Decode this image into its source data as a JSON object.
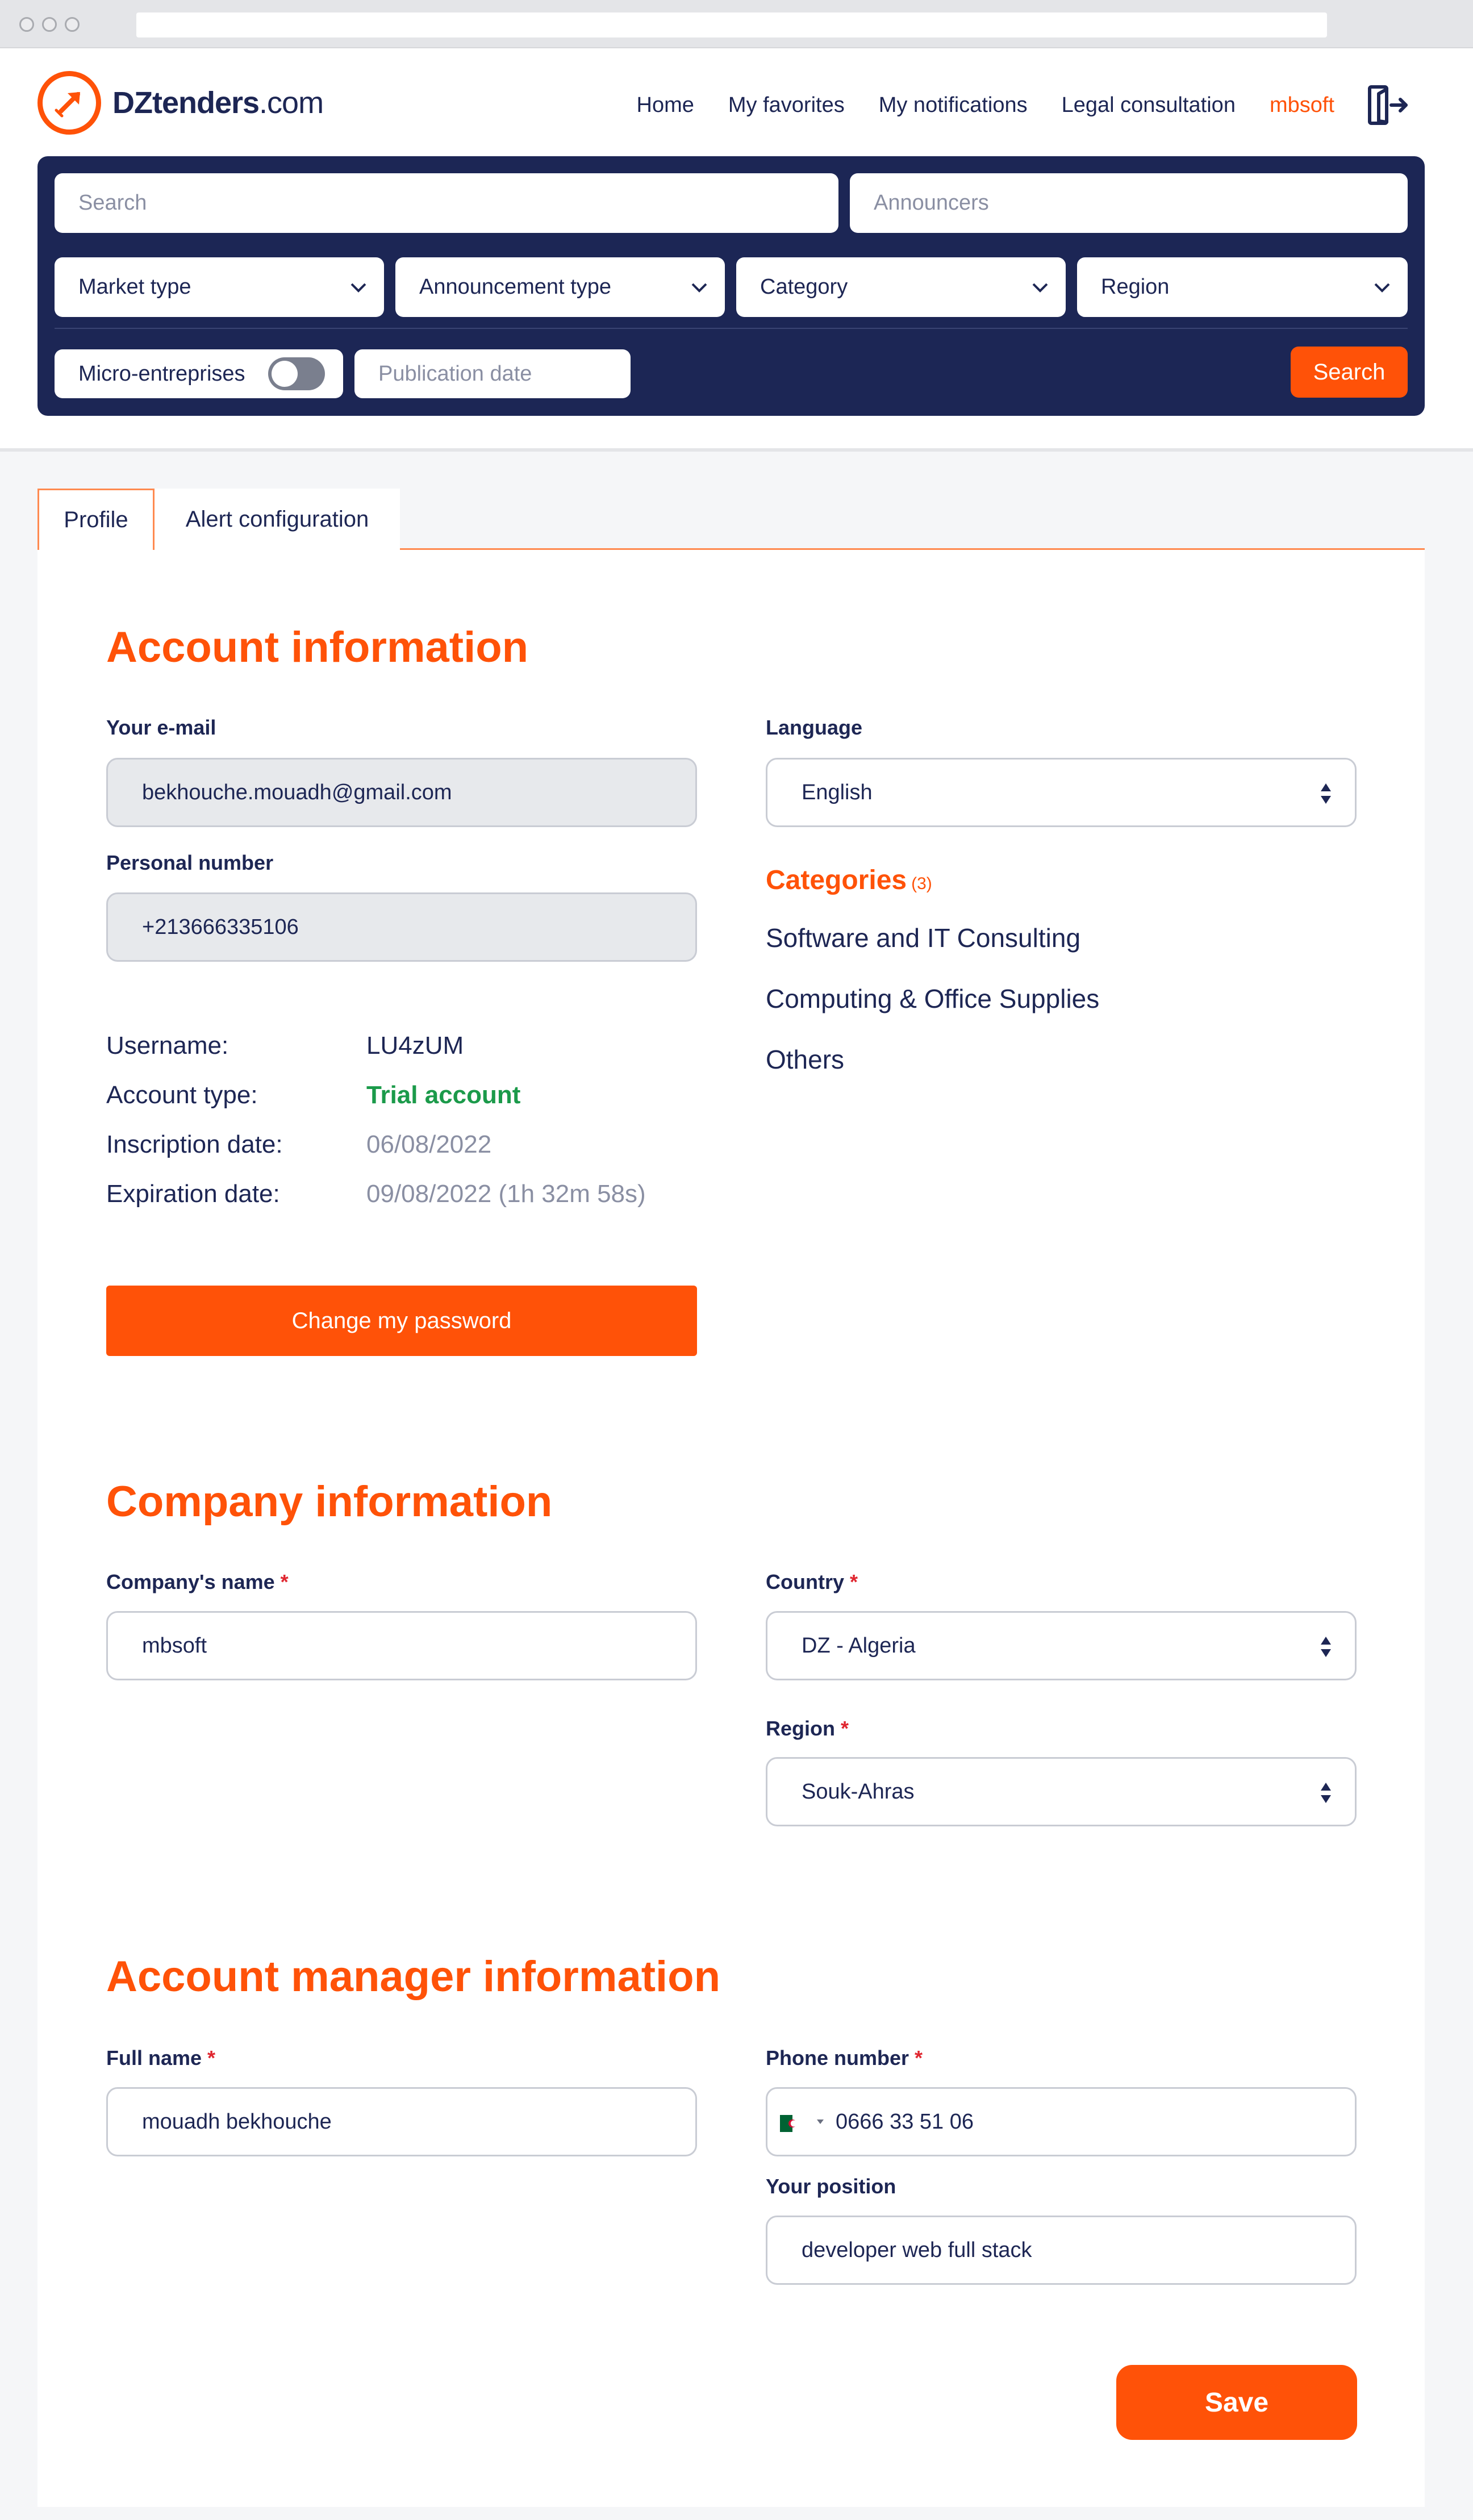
{
  "brand": {
    "name_bold": "DZtenders",
    "name_suffix": ".com",
    "accent": "#ff5208",
    "navy": "#1c2655"
  },
  "nav": {
    "home": "Home",
    "favorites": "My favorites",
    "notifications": "My notifications",
    "legal": "Legal consultation",
    "user": "mbsoft",
    "logout_icon": "logout-icon"
  },
  "search": {
    "search_placeholder": "Search",
    "announcers_placeholder": "Announcers",
    "market_type": "Market type",
    "announcement_type": "Announcement type",
    "category": "Category",
    "region": "Region",
    "micro": "Micro-entreprises",
    "micro_enabled": false,
    "publication_date": "Publication date",
    "button": "Search"
  },
  "tabs": {
    "profile": "Profile",
    "alerts": "Alert configuration",
    "active": "Profile"
  },
  "account": {
    "title": "Account information",
    "email_label": "Your e-mail",
    "email": "bekhouche.mouadh@gmail.com",
    "phone_label": "Personal number",
    "phone": "+213666335106",
    "language_label": "Language",
    "language": "English",
    "categories_title": "Categories",
    "categories_count": "(3)",
    "categories": [
      "Software and IT Consulting",
      "Computing & Office Supplies",
      "Others"
    ],
    "username_key": "Username:",
    "username": "LU4zUM",
    "type_key": "Account type:",
    "type": "Trial account",
    "inscription_key": "Inscription date:",
    "inscription": "06/08/2022",
    "expiration_key": "Expiration date:",
    "expiration": "09/08/2022 (1h 32m 58s)",
    "change_password": "Change my password"
  },
  "company": {
    "title": "Company information",
    "name_label": "Company's name",
    "name": "mbsoft",
    "country_label": "Country",
    "country": "DZ - Algeria",
    "region_label": "Region",
    "region": "Souk-Ahras",
    "required_mark": "*"
  },
  "manager": {
    "title": "Account manager information",
    "fullname_label": "Full name",
    "fullname": "mouadh bekhouche",
    "phone_label": "Phone number",
    "phone": "0666 33 51 06",
    "position_label": "Your position",
    "position": "developer web full stack",
    "save": "Save"
  }
}
